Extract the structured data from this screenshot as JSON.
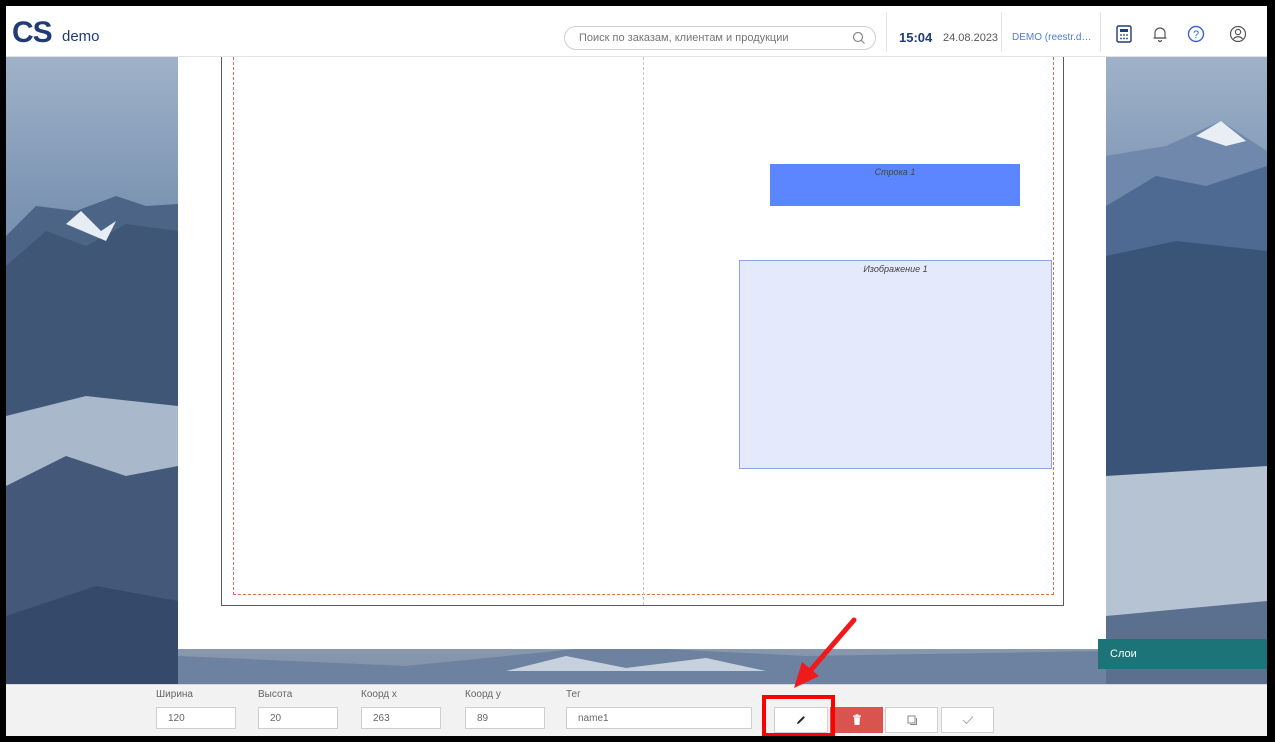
{
  "header": {
    "logo": "CS",
    "logo_sub": "demo",
    "search_placeholder": "Поиск по заказам, клиентам и продукции",
    "time": "15:04",
    "date": "24.08.2023",
    "user": "DEMO (reestr.digit..."
  },
  "canvas": {
    "objects": [
      {
        "label": "Строка 1",
        "color": "#5b86ff"
      },
      {
        "label": "Изображение 1",
        "color": "#e4e9fb"
      }
    ]
  },
  "layers_tab": {
    "label": "Слои",
    "color": "#1c7479"
  },
  "toolbar": {
    "fields": [
      {
        "label": "Ширина",
        "value": "120"
      },
      {
        "label": "Высота",
        "value": "20"
      },
      {
        "label": "Коорд x",
        "value": "263"
      },
      {
        "label": "Коорд y",
        "value": "89"
      },
      {
        "label": "Тег",
        "value": "name1"
      }
    ],
    "buttons": [
      {
        "icon": "pencil-icon"
      },
      {
        "icon": "trash-icon",
        "color": "#d9534f"
      },
      {
        "icon": "copy-icon"
      },
      {
        "icon": "check-icon"
      }
    ]
  },
  "annotation": {
    "highlight_color": "#ff0000"
  }
}
